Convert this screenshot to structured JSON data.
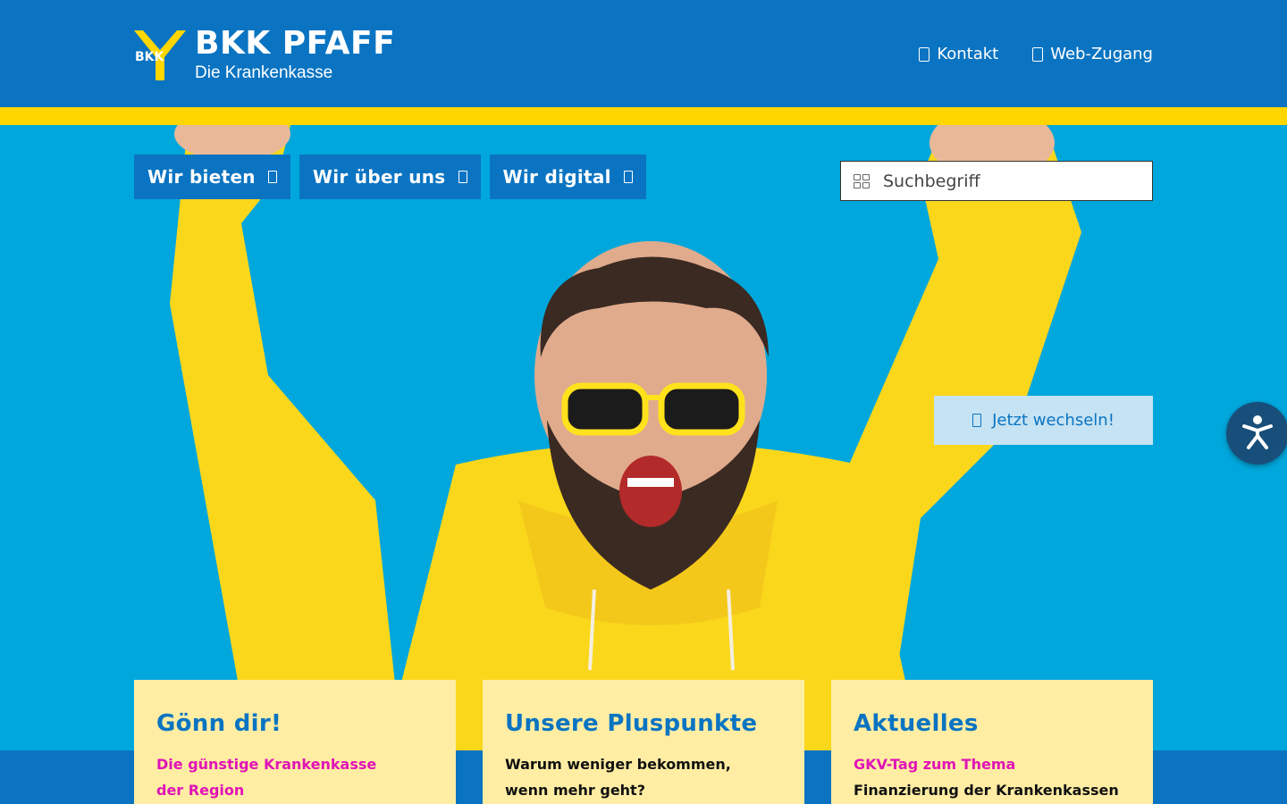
{
  "header": {
    "brand": "BKK PFAFF",
    "subtitle": "Die Krankenkasse",
    "logo_badge": "BKK",
    "links": [
      {
        "label": "Kontakt",
        "icon": "phone-icon"
      },
      {
        "label": "Web-Zugang",
        "icon": "lock-icon"
      }
    ]
  },
  "nav": {
    "items": [
      {
        "label": "Wir bieten"
      },
      {
        "label": "Wir über uns"
      },
      {
        "label": "Wir digital"
      }
    ]
  },
  "search": {
    "placeholder": "Suchbegriff"
  },
  "cta": {
    "label": "Jetzt wechseln!",
    "icon": "arrow-icon"
  },
  "cards": [
    {
      "title": "Gönn dir!",
      "lines": [
        "Die günstige Krankenkasse",
        "der Region"
      ]
    },
    {
      "title": "Unsere Pluspunkte",
      "lines": [
        "Warum weniger bekommen,",
        "wenn mehr geht?"
      ]
    },
    {
      "title": "Aktuelles",
      "lines": [
        "GKV-Tag zum Thema",
        "Finanzierung der Krankenkassen"
      ]
    }
  ],
  "colors": {
    "brand_blue": "#0a74c2",
    "brand_yellow": "#ffd600",
    "hero_bg": "#00a7dc",
    "card_bg": "#ffeda3",
    "accent_pink": "#e014b7",
    "a11y_bg": "#174f7a"
  }
}
